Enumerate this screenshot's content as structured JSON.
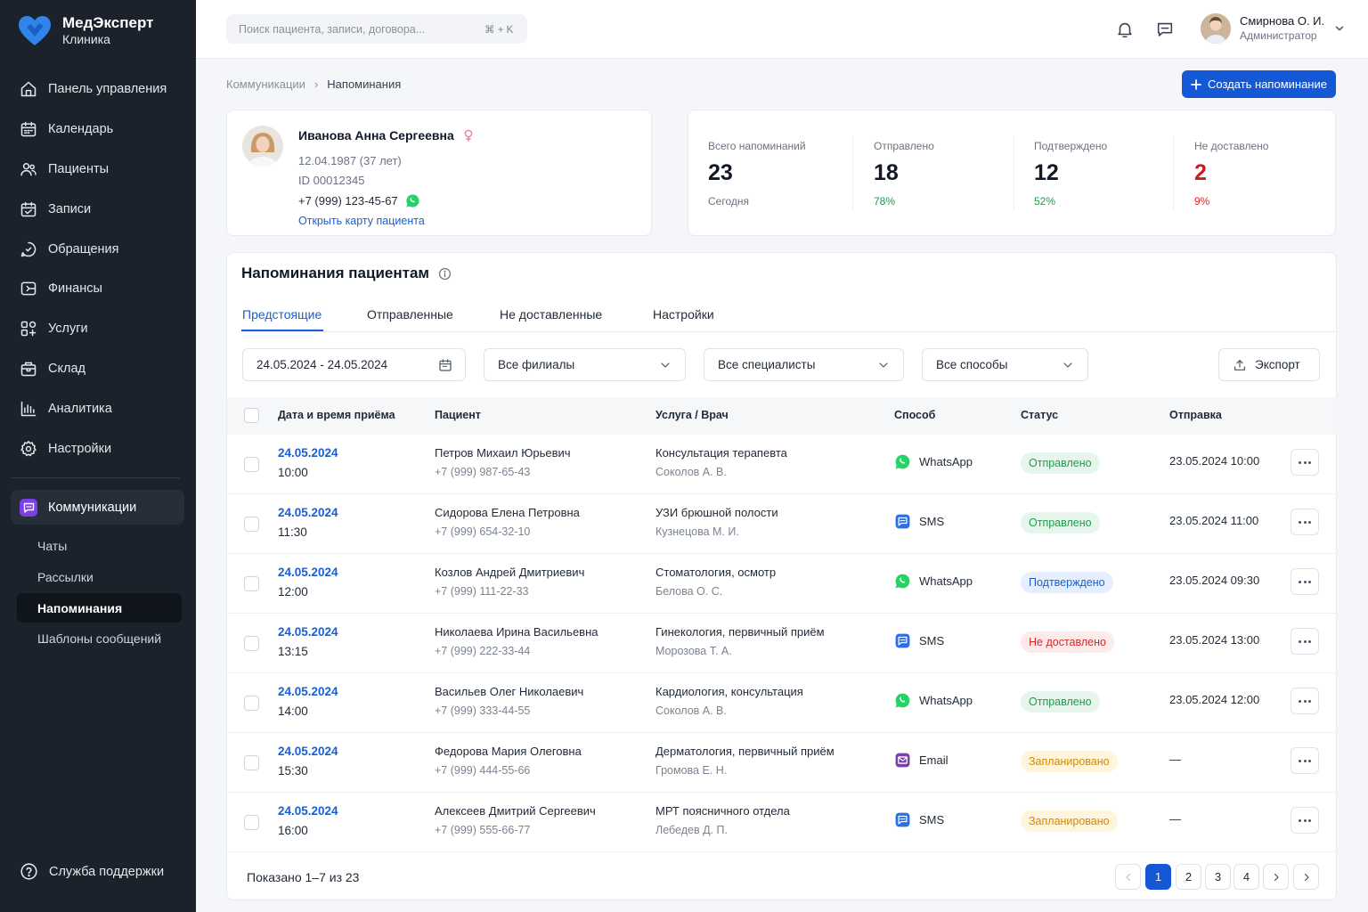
{
  "brand": {
    "name": "МедЭксперт",
    "subtitle": "Клиника"
  },
  "sidebar": {
    "items": [
      {
        "label": "Панель управления",
        "icon": "home-icon"
      },
      {
        "label": "Календарь",
        "icon": "calendar-icon"
      },
      {
        "label": "Пациенты",
        "icon": "users-icon"
      },
      {
        "label": "Записи",
        "icon": "records-icon"
      },
      {
        "label": "Обращения",
        "icon": "appeals-icon"
      },
      {
        "label": "Финансы",
        "icon": "wallet-icon"
      },
      {
        "label": "Услуги",
        "icon": "services-icon"
      },
      {
        "label": "Склад",
        "icon": "warehouse-icon"
      },
      {
        "label": "Аналитика",
        "icon": "chart-icon"
      },
      {
        "label": "Настройки",
        "icon": "gear-icon"
      }
    ],
    "communications": {
      "label": "Коммуникации",
      "icon": "chat-icon",
      "subitems": [
        {
          "label": "Чаты",
          "active": false
        },
        {
          "label": "Рассылки",
          "active": false
        },
        {
          "label": "Напоминания",
          "active": true
        },
        {
          "label": "Шаблоны сообщений",
          "active": false
        }
      ]
    },
    "support": "Служба поддержки"
  },
  "topbar": {
    "search_placeholder": "Поиск пациента, записи, договора...",
    "shortcut": "⌘ + K",
    "user": {
      "name": "Смирнова О. И.",
      "role": "Администратор"
    }
  },
  "breadcrumb": {
    "parent": "Коммуникации",
    "separator": "›",
    "current": "Напоминания"
  },
  "create_button": "Создать напоминание",
  "patient": {
    "name": "Иванова Анна Сергеевна",
    "birth": "12.04.1987 (37 лет)",
    "id": "ID 00012345",
    "phone": "+7 (999) 123-45-67",
    "link": "Открыть карту пациента"
  },
  "stats": [
    {
      "label": "Всего напоминаний",
      "value": "23",
      "sub": "Сегодня",
      "color": "#111827",
      "sub_color": "#6b7280"
    },
    {
      "label": "Отправлено",
      "value": "18",
      "sub": "78%",
      "color": "#111827",
      "sub_color": "#16a34a"
    },
    {
      "label": "Подтверждено",
      "value": "12",
      "sub": "52%",
      "color": "#111827",
      "sub_color": "#16a34a"
    },
    {
      "label": "Не доставлено",
      "value": "2",
      "sub": "9%",
      "color": "#c81e1e",
      "sub_color": "#dc2626"
    }
  ],
  "section": {
    "title": "Напоминания пациентам",
    "tabs": [
      {
        "label": "Предстоящие",
        "active": true
      },
      {
        "label": "Отправленные",
        "active": false
      },
      {
        "label": "Не доставленные",
        "active": false
      },
      {
        "label": "Настройки",
        "active": false
      }
    ],
    "filters": {
      "date_range": "24.05.2024 - 24.05.2024",
      "branches": "Все филиалы",
      "specialists": "Все специалисты",
      "methods": "Все способы",
      "export": "Экспорт"
    },
    "columns": [
      "Дата и время приёма",
      "Пациент",
      "Услуга / Врач",
      "Способ",
      "Статус",
      "Отправка"
    ]
  },
  "rows": [
    {
      "date": "24.05.2024",
      "time": "10:00",
      "patient": "Петров Михаил Юрьевич",
      "phone": "+7 (999) 987-65-43",
      "service": "Консультация терапевта",
      "doctor": "Соколов А. В.",
      "method": "WhatsApp",
      "status": "Отправлено",
      "status_type": "sent",
      "sent": "23.05.2024 10:00"
    },
    {
      "date": "24.05.2024",
      "time": "11:30",
      "patient": "Сидорова Елена Петровна",
      "phone": "+7 (999) 654-32-10",
      "service": "УЗИ брюшной полости",
      "doctor": "Кузнецова М. И.",
      "method": "SMS",
      "status": "Отправлено",
      "status_type": "sent",
      "sent": "23.05.2024 11:00"
    },
    {
      "date": "24.05.2024",
      "time": "12:00",
      "patient": "Козлов Андрей Дмитриевич",
      "phone": "+7 (999) 111-22-33",
      "service": "Стоматология, осмотр",
      "doctor": "Белова О. С.",
      "method": "WhatsApp",
      "status": "Подтверждено",
      "status_type": "confirmed",
      "sent": "23.05.2024 09:30"
    },
    {
      "date": "24.05.2024",
      "time": "13:15",
      "patient": "Николаева Ирина Васильевна",
      "phone": "+7 (999) 222-33-44",
      "service": "Гинекология, первичный приём",
      "doctor": "Морозова Т. А.",
      "method": "SMS",
      "status": "Не доставлено",
      "status_type": "failed",
      "sent": "23.05.2024 13:00"
    },
    {
      "date": "24.05.2024",
      "time": "14:00",
      "patient": "Васильев Олег Николаевич",
      "phone": "+7 (999) 333-44-55",
      "service": "Кардиология, консультация",
      "doctor": "Соколов А. В.",
      "method": "WhatsApp",
      "status": "Отправлено",
      "status_type": "sent",
      "sent": "23.05.2024 12:00"
    },
    {
      "date": "24.05.2024",
      "time": "15:30",
      "patient": "Федорова Мария Олеговна",
      "phone": "+7 (999) 444-55-66",
      "service": "Дерматология, первичный приём",
      "doctor": "Громова Е. Н.",
      "method": "Email",
      "status": "Запланировано",
      "status_type": "planned",
      "sent": "—"
    },
    {
      "date": "24.05.2024",
      "time": "16:00",
      "patient": "Алексеев Дмитрий Сергеевич",
      "phone": "+7 (999) 555-66-77",
      "service": "МРТ поясничного отдела",
      "doctor": "Лебедев Д. П.",
      "method": "SMS",
      "status": "Запланировано",
      "status_type": "planned",
      "sent": "—"
    }
  ],
  "status_styles": {
    "sent": {
      "bg": "#e7f6ec",
      "fg": "#1f9d4c"
    },
    "confirmed": {
      "bg": "#e6efff",
      "fg": "#1a5fd0"
    },
    "failed": {
      "bg": "#fdeaea",
      "fg": "#d12b2b"
    },
    "planned": {
      "bg": "#fff4dc",
      "fg": "#d18a06"
    }
  },
  "method_colors": {
    "WhatsApp": "#25d366",
    "SMS": "#2f6fe0",
    "Email": "#7b3fa8"
  },
  "pagination": {
    "shown": "Показано 1–7 из 23",
    "pages": [
      "1",
      "2",
      "3",
      "4"
    ],
    "current": "1"
  }
}
